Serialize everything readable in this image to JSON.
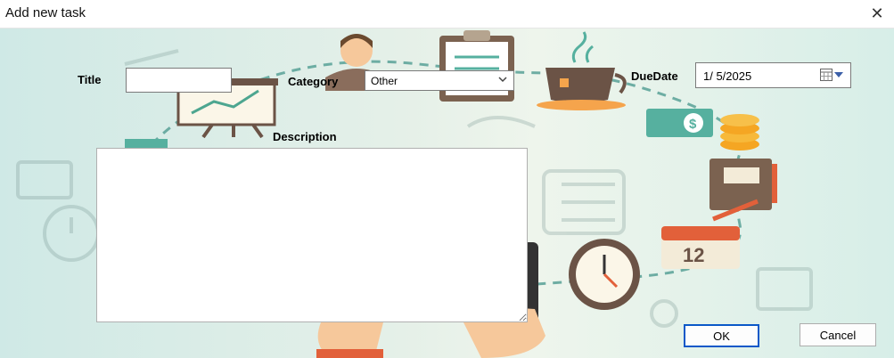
{
  "window": {
    "title": "Add new task",
    "close_icon": "close-icon"
  },
  "form": {
    "title_label": "Title",
    "title_value": "",
    "category_label": "Category",
    "category_value": "Other",
    "duedate_label": "DueDate",
    "duedate_value": "1/  5/2025",
    "description_label": "Description",
    "description_value": ""
  },
  "buttons": {
    "ok": "OK",
    "cancel": "Cancel"
  },
  "colors": {
    "accent": "#0a58c8",
    "background_tint": "#d9eee8"
  }
}
